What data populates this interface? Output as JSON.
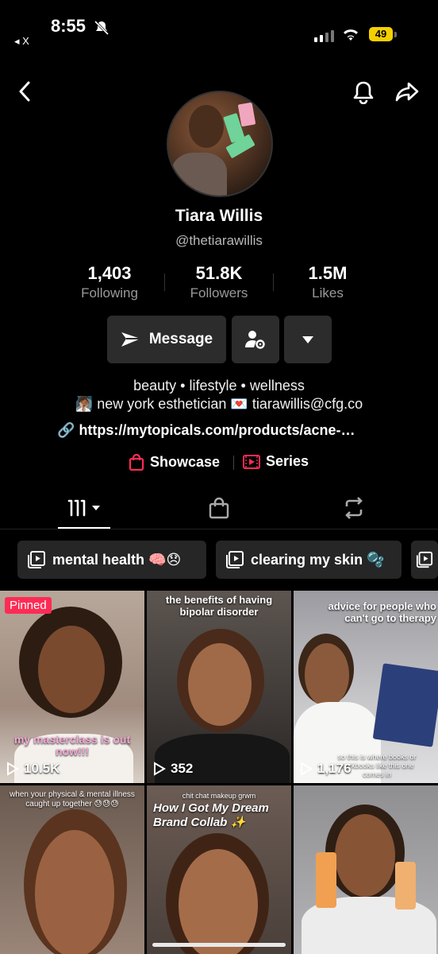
{
  "status_bar": {
    "time": "8:55",
    "back_app": "◂ X",
    "battery": "49"
  },
  "profile": {
    "name": "Tiara Willis",
    "handle": "@thetiarawillis",
    "stats": [
      {
        "value": "1,403",
        "label": "Following"
      },
      {
        "value": "51.8K",
        "label": "Followers"
      },
      {
        "value": "1.5M",
        "label": "Likes"
      }
    ],
    "message_label": "Message",
    "bio_line1": "beauty • lifestyle • wellness",
    "bio_line2_part1": "new york esthetician",
    "bio_line2_part2": "tiarawillis@cfg.co",
    "link": "https://mytopicals.com/products/acne-…",
    "showcase_label": "Showcase",
    "series_label": "Series"
  },
  "playlists": [
    {
      "label": "mental health 🧠😞"
    },
    {
      "label": "clearing my skin 🫧"
    }
  ],
  "videos": [
    {
      "views": "10.5K",
      "pinned": "Pinned",
      "caption": "my masterclass is out now!!!"
    },
    {
      "views": "352",
      "caption": "the benefits of having bipolar disorder"
    },
    {
      "views": "1,176",
      "caption": "advice for people who can't go to therapy",
      "sub_caption": "so this is where books or workbooks like this one comes in"
    },
    {
      "caption": "when your physical & mental illness caught up together 😓😓😓"
    },
    {
      "caption_small": "chit chat makeup grwm",
      "caption": "How I Got My Dream Brand Collab ✨"
    },
    {
      "caption": ""
    }
  ],
  "colors": {
    "accent": "#fe2c55",
    "background": "#000000",
    "button_bg": "#2c2c2c"
  }
}
